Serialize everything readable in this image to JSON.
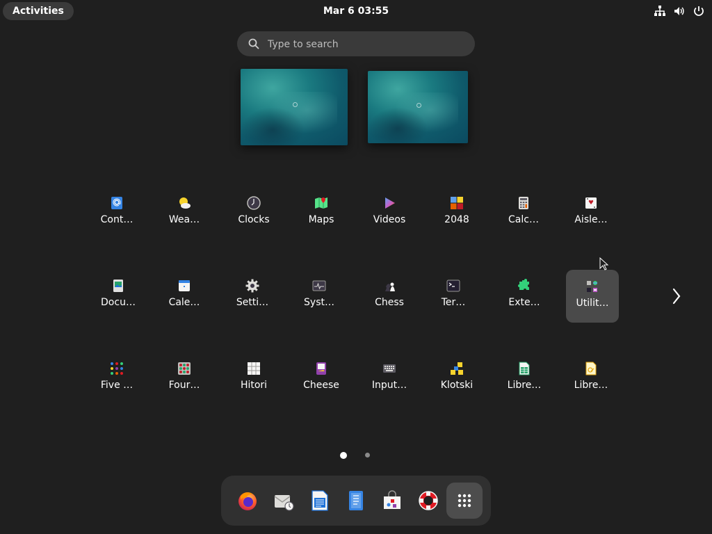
{
  "topbar": {
    "activities": "Activities",
    "clock": "Mar 6  03:55",
    "tray_icons": [
      "network-icon",
      "volume-icon",
      "power-icon"
    ]
  },
  "search": {
    "placeholder": "Type to search",
    "value": ""
  },
  "workspaces": [
    {
      "name": "workspace-1"
    },
    {
      "name": "workspace-2"
    }
  ],
  "apps": [
    {
      "label": "Cont…",
      "icon": "contacts-icon"
    },
    {
      "label": "Wea…",
      "icon": "weather-icon"
    },
    {
      "label": "Clocks",
      "icon": "clocks-icon"
    },
    {
      "label": "Maps",
      "icon": "maps-icon"
    },
    {
      "label": "Videos",
      "icon": "videos-icon"
    },
    {
      "label": "2048",
      "icon": "2048-icon"
    },
    {
      "label": "Calc…",
      "icon": "calculator-icon"
    },
    {
      "label": "Aisle…",
      "icon": "aisleriot-icon"
    },
    {
      "label": "Docu…",
      "icon": "document-viewer-icon"
    },
    {
      "label": "Cale…",
      "icon": "calendar-icon"
    },
    {
      "label": "Setti…",
      "icon": "settings-icon"
    },
    {
      "label": "Syst…",
      "icon": "system-monitor-icon"
    },
    {
      "label": "Chess",
      "icon": "chess-icon"
    },
    {
      "label": "Ter…",
      "icon": "terminal-icon"
    },
    {
      "label": "Exte…",
      "icon": "extensions-icon"
    },
    {
      "label": "Utilit…",
      "icon": "utilities-folder-icon",
      "focused": true
    },
    {
      "label": "Five …",
      "icon": "five-or-more-icon"
    },
    {
      "label": "Four…",
      "icon": "four-in-a-row-icon"
    },
    {
      "label": "Hitori",
      "icon": "hitori-icon"
    },
    {
      "label": "Cheese",
      "icon": "cheese-icon"
    },
    {
      "label": "Input…",
      "icon": "input-method-icon"
    },
    {
      "label": "Klotski",
      "icon": "klotski-icon"
    },
    {
      "label": "Libre…",
      "icon": "libreoffice-calc-icon"
    },
    {
      "label": "Libre…",
      "icon": "libreoffice-draw-icon"
    }
  ],
  "pagination": {
    "pages": 2,
    "current": 1
  },
  "dash": [
    {
      "name": "firefox-icon"
    },
    {
      "name": "evolution-icon"
    },
    {
      "name": "libreoffice-writer-icon"
    },
    {
      "name": "text-editor-icon"
    },
    {
      "name": "software-icon"
    },
    {
      "name": "help-icon"
    },
    {
      "name": "show-apps-icon",
      "active": true
    }
  ],
  "colors": {
    "background": "#1f1f1f",
    "panel": "#3a3a3a",
    "focus": "#4a4a4a"
  }
}
